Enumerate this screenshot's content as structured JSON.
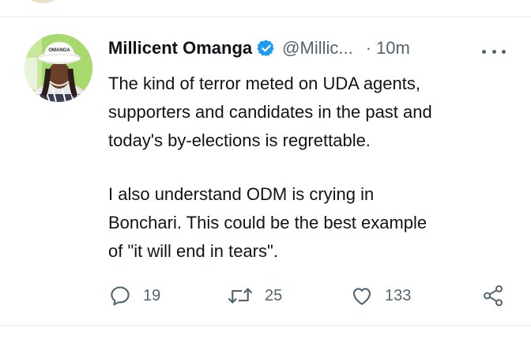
{
  "tweet": {
    "author_name": "Millicent Omanga",
    "handle": "@Millic...",
    "separator": "·",
    "time": "10m",
    "avatar_hat_text": "OMANGA",
    "lines": [
      "The kind of terror meted on UDA agents,",
      "supporters and candidates in the past and",
      "today's by-elections is regrettable.",
      "I also understand ODM is crying in",
      "Bonchari. This could be the best example",
      "of \"it will end in tears\"."
    ],
    "reply_count": "19",
    "retweet_count": "25",
    "like_count": "133"
  },
  "colors": {
    "text": "#0f1419",
    "secondary": "#536471",
    "verified": "#1d9bf0",
    "divider": "#e6ecf0"
  },
  "icons": [
    "verified-badge-icon",
    "more-options-icon",
    "reply-icon",
    "retweet-icon",
    "like-icon",
    "share-icon"
  ]
}
